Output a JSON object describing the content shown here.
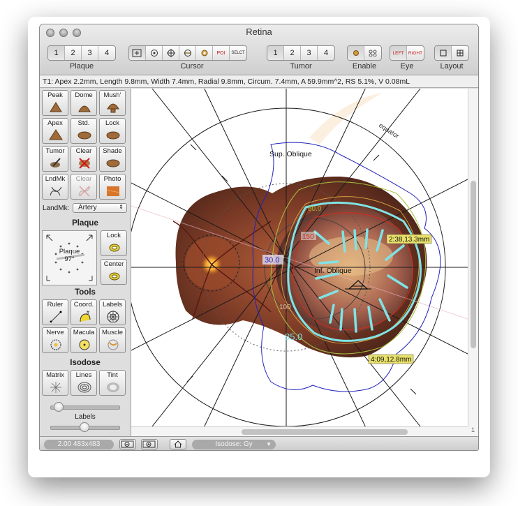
{
  "window": {
    "title": "Retina"
  },
  "toolbar": {
    "plaque": {
      "label": "Plaque",
      "buttons": [
        "1",
        "2",
        "3",
        "4"
      ]
    },
    "cursor": {
      "label": "Cursor",
      "poi": "POI",
      "select": "SELCT"
    },
    "tumor": {
      "label": "Tumor",
      "buttons": [
        "1",
        "2",
        "3",
        "4"
      ]
    },
    "enable": {
      "label": "Enable"
    },
    "eye": {
      "label": "Eye",
      "left": "LEFT",
      "right": "RIGHT"
    },
    "layout": {
      "label": "Layout"
    }
  },
  "status_line": "T1: Apex 2.2mm, Length 9.8mm, Width 7.4mm, Radial 9.8mm, Circum. 7.4mm, A 59.9mm^2, RS 5.1%, V 0.08mL",
  "sidebar": {
    "tools_row1": [
      "Peak",
      "Dome",
      "Mush'"
    ],
    "tools_row2": [
      "Apex",
      "Std.",
      "Lock"
    ],
    "tools_row3": [
      "Tumor",
      "Clear",
      "Shade"
    ],
    "tools_row4": [
      "LndMk",
      "Clear",
      "Photo"
    ],
    "landmark": {
      "label": "LandMk:",
      "value": "Artery"
    },
    "plaque_section": "Plaque",
    "plaque_preview": {
      "name": "Plaque",
      "angle": "97°"
    },
    "plaque_buttons": [
      "Lock",
      "Center"
    ],
    "tools_section": "Tools",
    "tools_a": [
      "Ruler",
      "Coord.",
      "Labels"
    ],
    "tools_b": [
      "Nerve",
      "Macula",
      "Muscle"
    ],
    "isodose_section": "Isodose",
    "isodose_buttons": [
      "Matrix",
      "Lines",
      "Tint"
    ],
    "labels_slider": "Labels"
  },
  "canvas": {
    "labels": {
      "sup_oblique": "Sup. Oblique",
      "inf_oblique": "Inf. Oblique",
      "equator": "equator",
      "iso60": "60.0",
      "iso150": "150",
      "iso30": "30.0",
      "iso100": "100",
      "iso85": "85.0",
      "coord1": "2:38,13.3mm",
      "coord2": "4:09,12.8mm"
    }
  },
  "footer": {
    "zoom": "2.00 483x483",
    "isodose": "Isodose: Gy"
  },
  "scroll_corner": "1",
  "colors": {
    "isodose_cyan": "#7fe3e6",
    "isodose_blue": "#2222bb",
    "coord_tag": "#e8e06a",
    "pilot_line": "#1a1a1a"
  }
}
